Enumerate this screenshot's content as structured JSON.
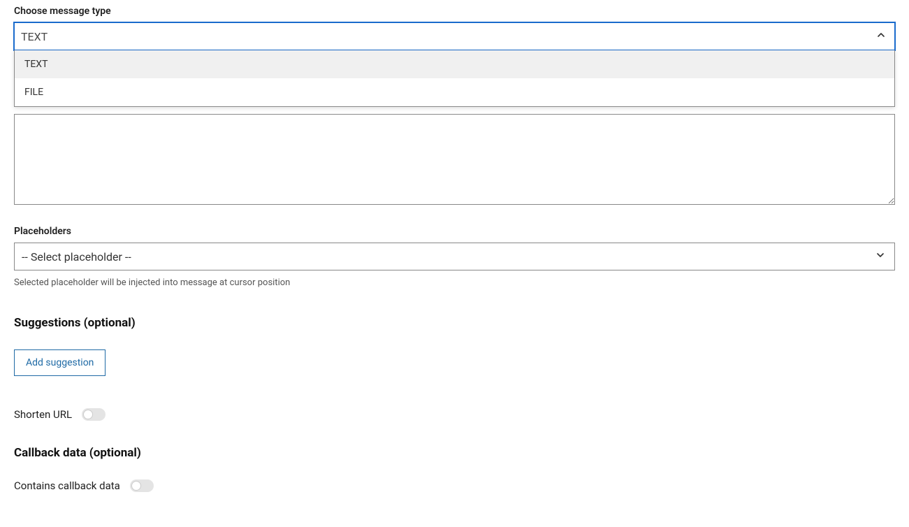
{
  "message_type": {
    "label": "Choose message type",
    "placeholder": "TEXT",
    "options": {
      "text": "TEXT",
      "file": "FILE"
    }
  },
  "placeholders": {
    "label": "Placeholders",
    "select_value": "-- Select placeholder --",
    "help_text": "Selected placeholder will be injected into message at cursor position"
  },
  "suggestions": {
    "heading": "Suggestions (optional)",
    "add_button": "Add suggestion"
  },
  "shorten_url": {
    "label": "Shorten URL",
    "enabled": false
  },
  "callback": {
    "heading": "Callback data (optional)",
    "contains_label": "Contains callback data",
    "enabled": false
  }
}
